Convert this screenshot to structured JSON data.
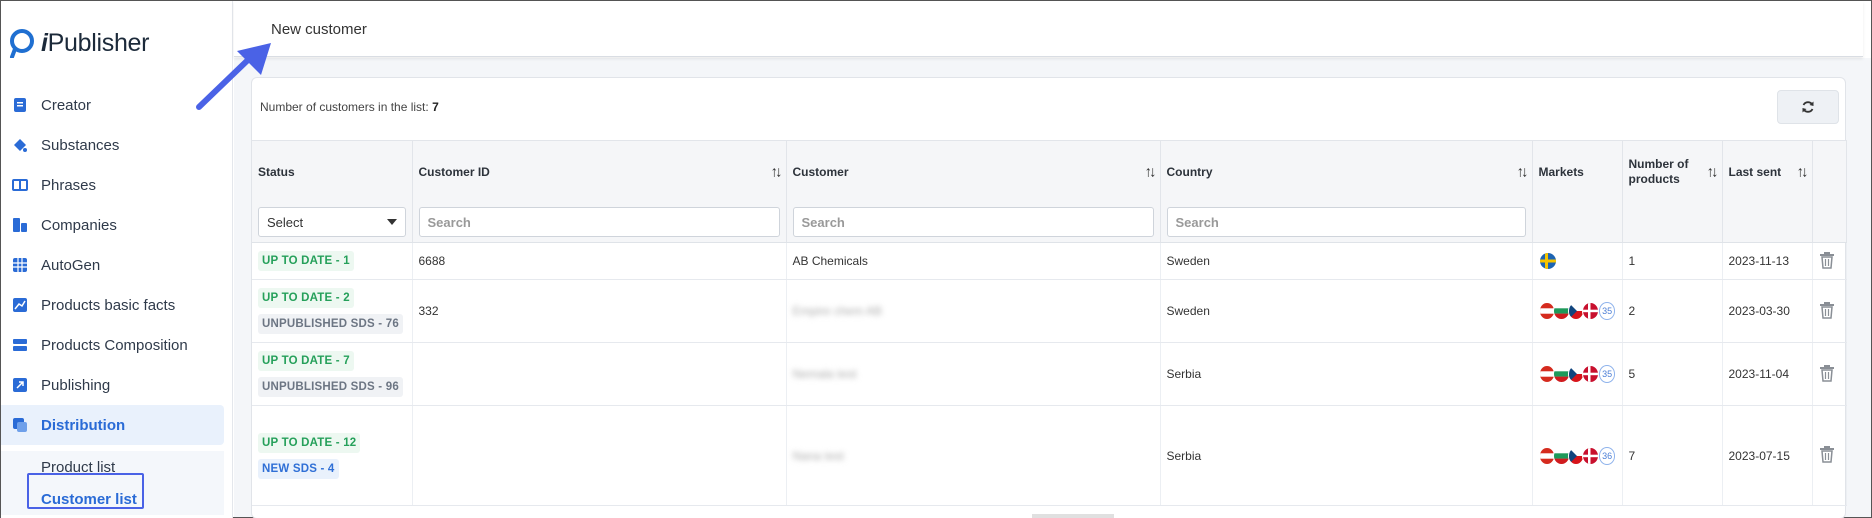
{
  "app": {
    "name_prefix": "i",
    "name_rest": "Publisher"
  },
  "sidebar": {
    "items": [
      {
        "label": "Creator",
        "icon": "document-icon"
      },
      {
        "label": "Substances",
        "icon": "flask-icon"
      },
      {
        "label": "Phrases",
        "icon": "book-icon"
      },
      {
        "label": "Companies",
        "icon": "building-icon"
      },
      {
        "label": "AutoGen",
        "icon": "grid-icon"
      },
      {
        "label": "Products basic facts",
        "icon": "chart-icon"
      },
      {
        "label": "Products Composition",
        "icon": "layers-icon"
      },
      {
        "label": "Publishing",
        "icon": "publish-icon"
      },
      {
        "label": "Distribution",
        "icon": "distribution-icon"
      }
    ],
    "sub_items": [
      {
        "label": "Product list"
      },
      {
        "label": "Customer list"
      }
    ]
  },
  "topbar": {
    "title": "New customer"
  },
  "list": {
    "count_label": "Number of customers in the list:",
    "count_value": "7"
  },
  "table": {
    "headers": {
      "status": "Status",
      "customer_id": "Customer ID",
      "customer": "Customer",
      "country": "Country",
      "markets": "Markets",
      "num_products": "Number of products",
      "last_sent": "Last sent"
    },
    "filters": {
      "status_select": "Select",
      "search_placeholder": "Search"
    },
    "rows": [
      {
        "badges": [
          {
            "text": "UP TO DATE - 1",
            "kind": "green"
          }
        ],
        "customer_id": "6688",
        "customer": "AB Chemicals",
        "customer_blurred": false,
        "country": "Sweden",
        "flags": [
          "se"
        ],
        "more": "",
        "num_products": "1",
        "last_sent": "2023-11-13"
      },
      {
        "badges": [
          {
            "text": "UP TO DATE - 2",
            "kind": "green"
          },
          {
            "text": "UNPUBLISHED SDS - 76",
            "kind": "gray"
          }
        ],
        "customer_id": "332",
        "customer": "Empire chem AB",
        "customer_blurred": true,
        "country": "Sweden",
        "flags": [
          "at",
          "bg",
          "cz",
          "dk"
        ],
        "more": "35",
        "num_products": "2",
        "last_sent": "2023-03-30"
      },
      {
        "badges": [
          {
            "text": "UP TO DATE - 7",
            "kind": "green"
          },
          {
            "text": "UNPUBLISHED SDS - 96",
            "kind": "gray"
          }
        ],
        "customer_id": "",
        "customer": "Nemala test",
        "customer_blurred": true,
        "country": "Serbia",
        "flags": [
          "at",
          "bg",
          "cz",
          "dk"
        ],
        "more": "35",
        "num_products": "5",
        "last_sent": "2023-11-04"
      },
      {
        "badges": [
          {
            "text": "UP TO DATE - 12",
            "kind": "green"
          },
          {
            "text": "NEW SDS - 4",
            "kind": "blue"
          }
        ],
        "customer_id": "",
        "customer": "Nana test",
        "customer_blurred": true,
        "country": "Serbia",
        "flags": [
          "at",
          "bg",
          "cz",
          "dk"
        ],
        "more": "36",
        "num_products": "7",
        "last_sent": "2023-07-15"
      }
    ]
  },
  "colors": {
    "accent": "#2a6bd6",
    "annotation": "#4a62e6",
    "status_green": "#25a05a",
    "status_gray": "#6c7583",
    "status_blue": "#2f6fd6"
  }
}
